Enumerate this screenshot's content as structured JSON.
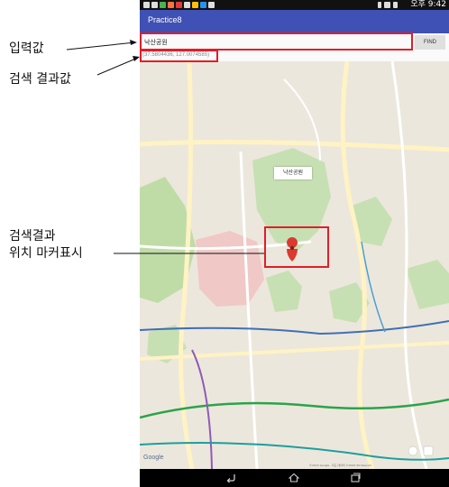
{
  "annotations": {
    "input_value": "입력값",
    "search_result": "검색 결과값",
    "marker_line1": "검색결과",
    "marker_line2": "위치 마커표시"
  },
  "status_bar": {
    "time": "오후 9:42"
  },
  "app": {
    "title": "Practice8"
  },
  "search": {
    "value": "낙산공원",
    "find_label": "FIND",
    "coordinates": "(37.5804436, 127.0074585)"
  },
  "map": {
    "marker_title": "낙산공원",
    "attribution": "©2015 Google · 지도 데이터 ©2015 SK telecom",
    "google_logo": "Google"
  },
  "colors": {
    "annotation_box": "#e01e2a",
    "app_bar": "#3f51b5",
    "marker": "#d93b30"
  },
  "icons": {
    "nav": [
      "back-icon",
      "home-icon",
      "recents-icon"
    ]
  }
}
